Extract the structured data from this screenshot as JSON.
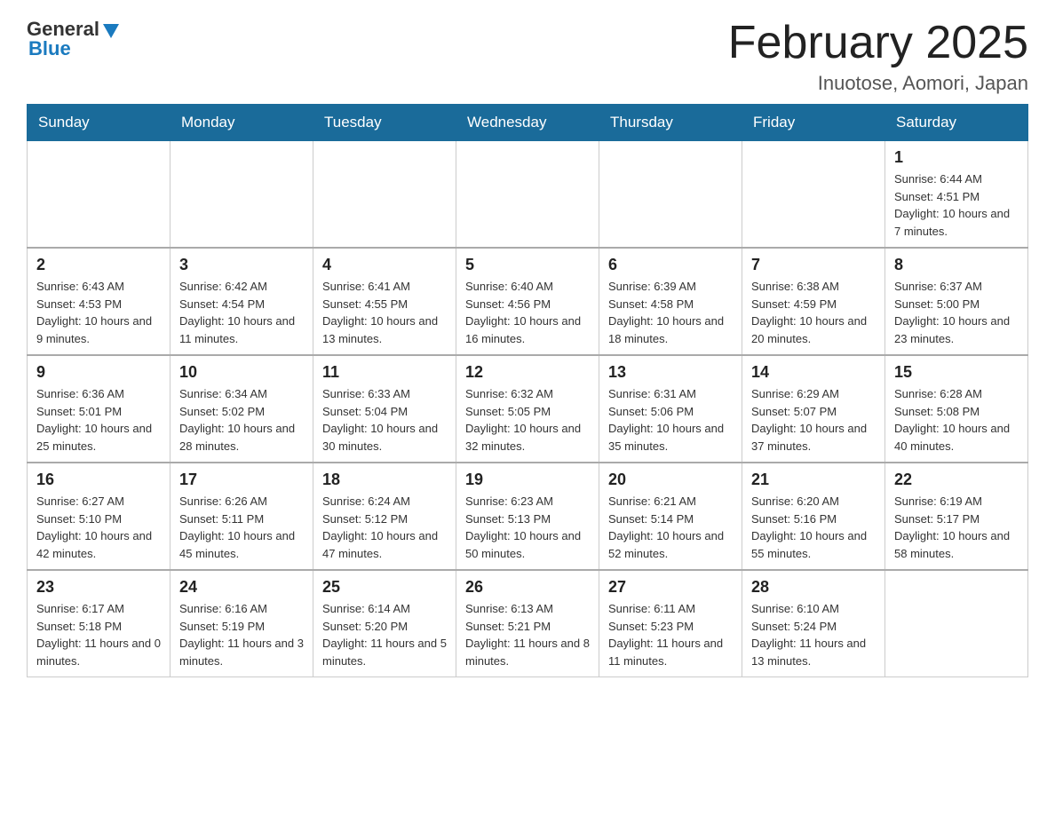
{
  "header": {
    "logo_general": "General",
    "logo_blue": "Blue",
    "title": "February 2025",
    "subtitle": "Inuotose, Aomori, Japan"
  },
  "days_of_week": [
    "Sunday",
    "Monday",
    "Tuesday",
    "Wednesday",
    "Thursday",
    "Friday",
    "Saturday"
  ],
  "weeks": [
    [
      null,
      null,
      null,
      null,
      null,
      null,
      {
        "day": 1,
        "sunrise": "6:44 AM",
        "sunset": "4:51 PM",
        "daylight": "10 hours and 7 minutes."
      }
    ],
    [
      {
        "day": 2,
        "sunrise": "6:43 AM",
        "sunset": "4:53 PM",
        "daylight": "10 hours and 9 minutes."
      },
      {
        "day": 3,
        "sunrise": "6:42 AM",
        "sunset": "4:54 PM",
        "daylight": "10 hours and 11 minutes."
      },
      {
        "day": 4,
        "sunrise": "6:41 AM",
        "sunset": "4:55 PM",
        "daylight": "10 hours and 13 minutes."
      },
      {
        "day": 5,
        "sunrise": "6:40 AM",
        "sunset": "4:56 PM",
        "daylight": "10 hours and 16 minutes."
      },
      {
        "day": 6,
        "sunrise": "6:39 AM",
        "sunset": "4:58 PM",
        "daylight": "10 hours and 18 minutes."
      },
      {
        "day": 7,
        "sunrise": "6:38 AM",
        "sunset": "4:59 PM",
        "daylight": "10 hours and 20 minutes."
      },
      {
        "day": 8,
        "sunrise": "6:37 AM",
        "sunset": "5:00 PM",
        "daylight": "10 hours and 23 minutes."
      }
    ],
    [
      {
        "day": 9,
        "sunrise": "6:36 AM",
        "sunset": "5:01 PM",
        "daylight": "10 hours and 25 minutes."
      },
      {
        "day": 10,
        "sunrise": "6:34 AM",
        "sunset": "5:02 PM",
        "daylight": "10 hours and 28 minutes."
      },
      {
        "day": 11,
        "sunrise": "6:33 AM",
        "sunset": "5:04 PM",
        "daylight": "10 hours and 30 minutes."
      },
      {
        "day": 12,
        "sunrise": "6:32 AM",
        "sunset": "5:05 PM",
        "daylight": "10 hours and 32 minutes."
      },
      {
        "day": 13,
        "sunrise": "6:31 AM",
        "sunset": "5:06 PM",
        "daylight": "10 hours and 35 minutes."
      },
      {
        "day": 14,
        "sunrise": "6:29 AM",
        "sunset": "5:07 PM",
        "daylight": "10 hours and 37 minutes."
      },
      {
        "day": 15,
        "sunrise": "6:28 AM",
        "sunset": "5:08 PM",
        "daylight": "10 hours and 40 minutes."
      }
    ],
    [
      {
        "day": 16,
        "sunrise": "6:27 AM",
        "sunset": "5:10 PM",
        "daylight": "10 hours and 42 minutes."
      },
      {
        "day": 17,
        "sunrise": "6:26 AM",
        "sunset": "5:11 PM",
        "daylight": "10 hours and 45 minutes."
      },
      {
        "day": 18,
        "sunrise": "6:24 AM",
        "sunset": "5:12 PM",
        "daylight": "10 hours and 47 minutes."
      },
      {
        "day": 19,
        "sunrise": "6:23 AM",
        "sunset": "5:13 PM",
        "daylight": "10 hours and 50 minutes."
      },
      {
        "day": 20,
        "sunrise": "6:21 AM",
        "sunset": "5:14 PM",
        "daylight": "10 hours and 52 minutes."
      },
      {
        "day": 21,
        "sunrise": "6:20 AM",
        "sunset": "5:16 PM",
        "daylight": "10 hours and 55 minutes."
      },
      {
        "day": 22,
        "sunrise": "6:19 AM",
        "sunset": "5:17 PM",
        "daylight": "10 hours and 58 minutes."
      }
    ],
    [
      {
        "day": 23,
        "sunrise": "6:17 AM",
        "sunset": "5:18 PM",
        "daylight": "11 hours and 0 minutes."
      },
      {
        "day": 24,
        "sunrise": "6:16 AM",
        "sunset": "5:19 PM",
        "daylight": "11 hours and 3 minutes."
      },
      {
        "day": 25,
        "sunrise": "6:14 AM",
        "sunset": "5:20 PM",
        "daylight": "11 hours and 5 minutes."
      },
      {
        "day": 26,
        "sunrise": "6:13 AM",
        "sunset": "5:21 PM",
        "daylight": "11 hours and 8 minutes."
      },
      {
        "day": 27,
        "sunrise": "6:11 AM",
        "sunset": "5:23 PM",
        "daylight": "11 hours and 11 minutes."
      },
      {
        "day": 28,
        "sunrise": "6:10 AM",
        "sunset": "5:24 PM",
        "daylight": "11 hours and 13 minutes."
      },
      null
    ]
  ]
}
